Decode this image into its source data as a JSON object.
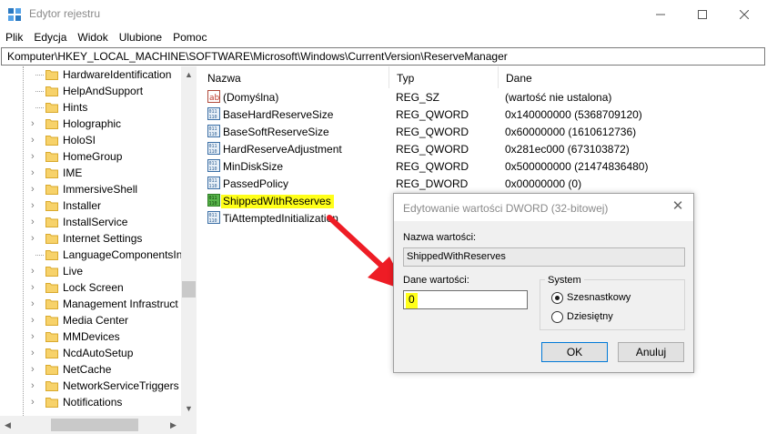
{
  "window": {
    "title": "Edytor rejestru"
  },
  "menu": [
    "Plik",
    "Edycja",
    "Widok",
    "Ulubione",
    "Pomoc"
  ],
  "address": "Komputer\\HKEY_LOCAL_MACHINE\\SOFTWARE\\Microsoft\\Windows\\CurrentVersion\\ReserveManager",
  "tree": [
    {
      "label": "HardwareIdentification",
      "chevron": false
    },
    {
      "label": "HelpAndSupport",
      "chevron": false
    },
    {
      "label": "Hints",
      "chevron": false
    },
    {
      "label": "Holographic",
      "chevron": true
    },
    {
      "label": "HoloSI",
      "chevron": true
    },
    {
      "label": "HomeGroup",
      "chevron": true
    },
    {
      "label": "IME",
      "chevron": true
    },
    {
      "label": "ImmersiveShell",
      "chevron": true
    },
    {
      "label": "Installer",
      "chevron": true
    },
    {
      "label": "InstallService",
      "chevron": true
    },
    {
      "label": "Internet Settings",
      "chevron": true
    },
    {
      "label": "LanguageComponentsIn",
      "chevron": false
    },
    {
      "label": "Live",
      "chevron": true
    },
    {
      "label": "Lock Screen",
      "chevron": true
    },
    {
      "label": "Management Infrastruct",
      "chevron": true
    },
    {
      "label": "Media Center",
      "chevron": true
    },
    {
      "label": "MMDevices",
      "chevron": true
    },
    {
      "label": "NcdAutoSetup",
      "chevron": true
    },
    {
      "label": "NetCache",
      "chevron": true
    },
    {
      "label": "NetworkServiceTriggers",
      "chevron": true
    },
    {
      "label": "Notifications",
      "chevron": true
    }
  ],
  "columns": {
    "name": "Nazwa",
    "type": "Typ",
    "data": "Dane"
  },
  "values": [
    {
      "name": "(Domyślna)",
      "type": "REG_SZ",
      "data": "(wartość nie ustalona)",
      "icon": "string-value-icon"
    },
    {
      "name": "BaseHardReserveSize",
      "type": "REG_QWORD",
      "data": "0x140000000 (5368709120)",
      "icon": "binary-value-icon"
    },
    {
      "name": "BaseSoftReserveSize",
      "type": "REG_QWORD",
      "data": "0x60000000 (1610612736)",
      "icon": "binary-value-icon"
    },
    {
      "name": "HardReserveAdjustment",
      "type": "REG_QWORD",
      "data": "0x281ec000 (673103872)",
      "icon": "binary-value-icon"
    },
    {
      "name": "MinDiskSize",
      "type": "REG_QWORD",
      "data": "0x500000000 (21474836480)",
      "icon": "binary-value-icon"
    },
    {
      "name": "PassedPolicy",
      "type": "REG_DWORD",
      "data": "0x00000000 (0)",
      "icon": "binary-value-icon"
    },
    {
      "name": "ShippedWithReserves",
      "type": "",
      "data": "",
      "icon": "binary-value-icon",
      "highlight": true
    },
    {
      "name": "TiAttemptedInitialization",
      "type": "",
      "data": "",
      "icon": "binary-value-icon"
    }
  ],
  "dialog": {
    "title": "Edytowanie wartości DWORD (32-bitowej)",
    "name_label": "Nazwa wartości:",
    "name_value": "ShippedWithReserves",
    "data_label": "Dane wartości:",
    "data_value": "0",
    "base_label": "System",
    "radio_hex": "Szesnastkowy",
    "radio_dec": "Dziesiętny",
    "selected_base": "hex",
    "ok": "OK",
    "cancel": "Anuluj"
  },
  "colors": {
    "highlight": "#ffff19",
    "arrow": "#ee1c25",
    "accent": "#0078d7"
  }
}
